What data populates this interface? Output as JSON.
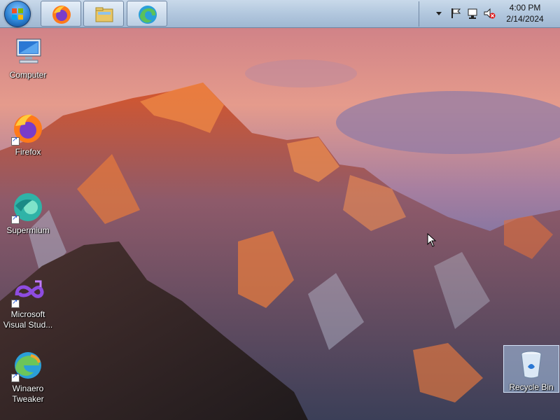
{
  "taskbar": {
    "start_icon": "windows-orb-icon",
    "pinned": [
      {
        "name": "firefox",
        "icon": "firefox-icon"
      },
      {
        "name": "explorer",
        "icon": "folder-icon"
      },
      {
        "name": "edge",
        "icon": "edge-icon"
      }
    ],
    "tray_icons": [
      "chevron-up-icon",
      "flag-icon",
      "network-icon",
      "speaker-muted-icon"
    ],
    "clock": {
      "time": "4:00 PM",
      "date": "2/14/2024"
    }
  },
  "desktop": {
    "icons": [
      {
        "id": "computer",
        "label": "Computer",
        "icon": "computer-icon",
        "shortcut": false
      },
      {
        "id": "firefox",
        "label": "Firefox",
        "icon": "firefox-icon",
        "shortcut": true
      },
      {
        "id": "supermium",
        "label": "Supermium",
        "icon": "supermium-icon",
        "shortcut": true
      },
      {
        "id": "vs",
        "label": "Microsoft Visual Stud...",
        "icon": "visual-studio-icon",
        "shortcut": true
      },
      {
        "id": "winaero",
        "label": "Winaero Tweaker",
        "icon": "winaero-tweaker-icon",
        "shortcut": true
      },
      {
        "id": "recycle",
        "label": "Recycle Bin",
        "icon": "recycle-bin-icon",
        "shortcut": false
      }
    ]
  },
  "colors": {
    "taskbar": "#b4c9df",
    "sky_top": "#d98a8a",
    "sky_bottom": "#6a6fa8",
    "peak_glow": "#e8743a"
  }
}
